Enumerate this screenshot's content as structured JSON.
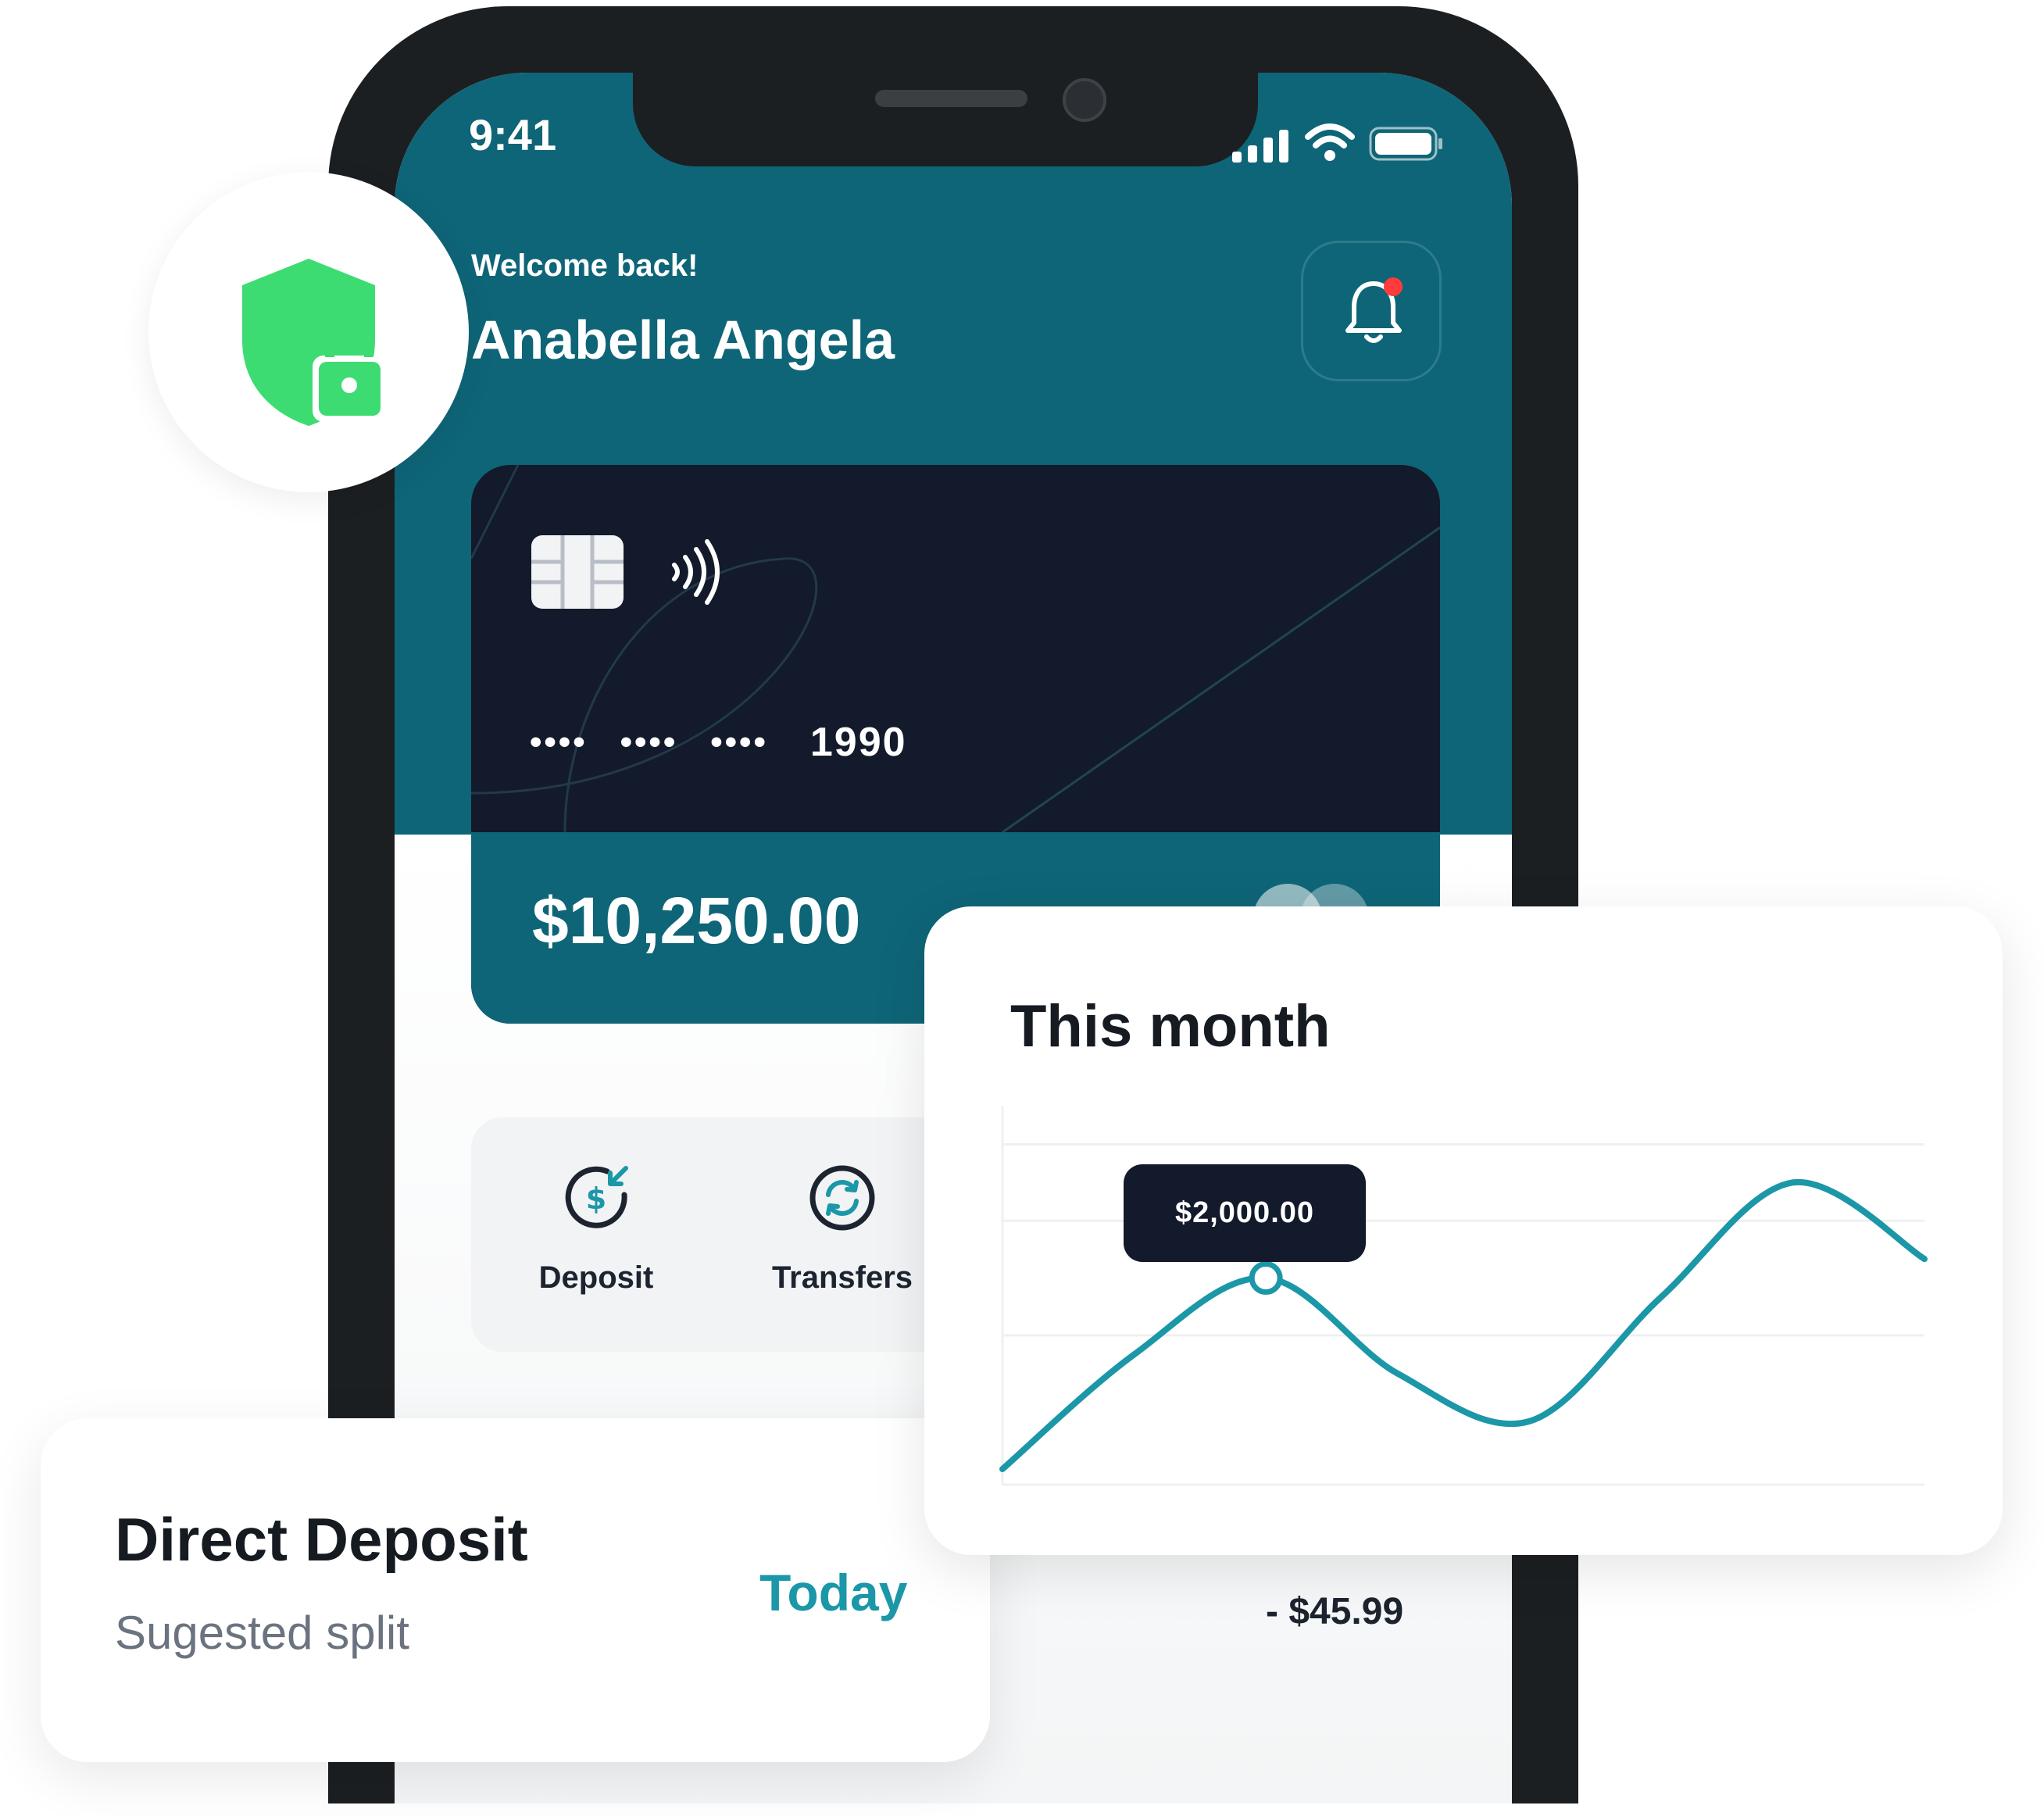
{
  "status_bar": {
    "time": "9:41"
  },
  "header": {
    "welcome": "Welcome back!",
    "user_name": "Anabella Angela"
  },
  "card": {
    "mask_groups": [
      "••••",
      "••••",
      "••••"
    ],
    "last4": "1990",
    "balance": "$10,250.00"
  },
  "actions": [
    {
      "label": "Deposit",
      "icon": "deposit-icon"
    },
    {
      "label": "Transfers",
      "icon": "transfers-icon"
    }
  ],
  "transaction": {
    "amount": "- $45.99"
  },
  "direct_deposit": {
    "title": "Direct Deposit",
    "subtitle": "Sugested split",
    "date": "Today"
  },
  "month_card": {
    "title": "This month",
    "tooltip": "$2,000.00"
  },
  "chart_data": {
    "type": "line",
    "title": "This month",
    "x": [
      0,
      1,
      2,
      3,
      4,
      5,
      6,
      7
    ],
    "series": [
      {
        "values": [
          0,
          1200,
          2000,
          1000,
          500,
          1800,
          3000,
          2200
        ]
      }
    ],
    "highlight_index": 2,
    "highlight_label": "$2,000.00",
    "ylim": [
      0,
      3600
    ],
    "grid": true
  },
  "colors": {
    "teal": "#0e6577",
    "accent": "#1b97a8",
    "card_dark": "#131a2b",
    "shield_green": "#3ddc72",
    "notification_dot": "#ff3b3b"
  }
}
